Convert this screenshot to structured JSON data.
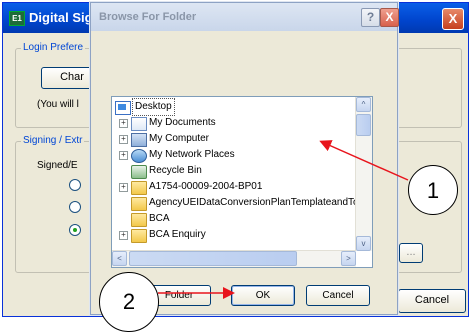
{
  "background_window": {
    "app_icon_text": "E1",
    "title": "Digital Sig",
    "close_glyph": "X",
    "login_group_label": "Login Prefere",
    "change_button_label": "Char",
    "note_text": "(You will l",
    "signing_group_label": "Signing / Extr",
    "signed_label": "Signed/E",
    "cancel_button_label": "Cancel",
    "ellipsis_button_label": "..."
  },
  "dialog": {
    "title": "Browse For Folder",
    "help_glyph": "?",
    "close_glyph": "X",
    "make_folder_label": "Folder",
    "ok_label": "OK",
    "cancel_label": "Cancel"
  },
  "tree": {
    "items": [
      {
        "label": "Desktop",
        "icon": "desktop-icon",
        "expander": ""
      },
      {
        "label": "My Documents",
        "icon": "my-documents-icon",
        "expander": "+"
      },
      {
        "label": "My Computer",
        "icon": "my-computer-icon",
        "expander": "+"
      },
      {
        "label": "My Network Places",
        "icon": "network-places-icon",
        "expander": "+"
      },
      {
        "label": "Recycle Bin",
        "icon": "recycle-bin-icon",
        "expander": ""
      },
      {
        "label": "A1754-00009-2004-BP01",
        "icon": "folder-icon",
        "expander": "+"
      },
      {
        "label": "AgencyUEIDataConversionPlanTemplateandTo",
        "icon": "folder-icon",
        "expander": ""
      },
      {
        "label": "BCA",
        "icon": "folder-icon",
        "expander": ""
      },
      {
        "label": "BCA Enquiry",
        "icon": "folder-icon",
        "expander": "+"
      }
    ],
    "scroll_up": "^",
    "scroll_down": "v",
    "scroll_left": "<",
    "scroll_right": ">"
  },
  "annotations": {
    "callout_1": "1",
    "callout_2": "2",
    "arrow_color": "#e8141c"
  }
}
